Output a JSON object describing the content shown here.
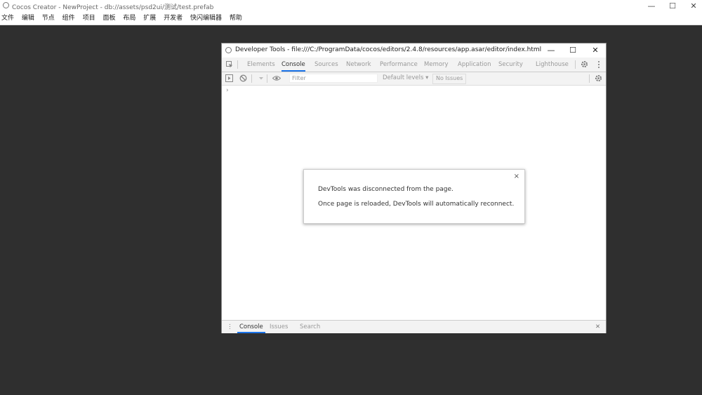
{
  "app": {
    "title": "Cocos Creator - NewProject - db://assets/psd2ui/测试/test.prefab",
    "logo_icon": "cocos-logo-icon",
    "window_controls": {
      "minimize": "—",
      "maximize": "☐",
      "close": "✕"
    }
  },
  "menubar": {
    "items": [
      "文件",
      "编辑",
      "节点",
      "组件",
      "项目",
      "面板",
      "布局",
      "扩展",
      "开发者",
      "快闪编辑器",
      "帮助"
    ]
  },
  "devtools": {
    "title": "Developer Tools - file:///C:/ProgramData/cocos/editors/2.4.8/resources/app.asar/editor/index.html",
    "window_controls": {
      "minimize": "—",
      "maximize": "☐",
      "close": "✕"
    },
    "tabs": [
      "Elements",
      "Console",
      "Sources",
      "Network",
      "Performance",
      "Memory",
      "Application",
      "Security",
      "Lighthouse"
    ],
    "active_tab": "Console",
    "toolbar": {
      "filter_placeholder": "Filter",
      "levels": "Default levels ▾",
      "no_issues": "No Issues"
    },
    "prompt": "›",
    "dialog": {
      "close": "×",
      "line1": "DevTools was disconnected from the page.",
      "line2": "Once page is reloaded, DevTools will automatically reconnect."
    },
    "drawer": {
      "menu": "⋮",
      "tabs": [
        "Console",
        "Issues",
        "Search"
      ],
      "active_tab": "Console",
      "close": "✕"
    }
  },
  "colors": {
    "background": "#2f2f2f",
    "accent": "#1a73e8"
  }
}
